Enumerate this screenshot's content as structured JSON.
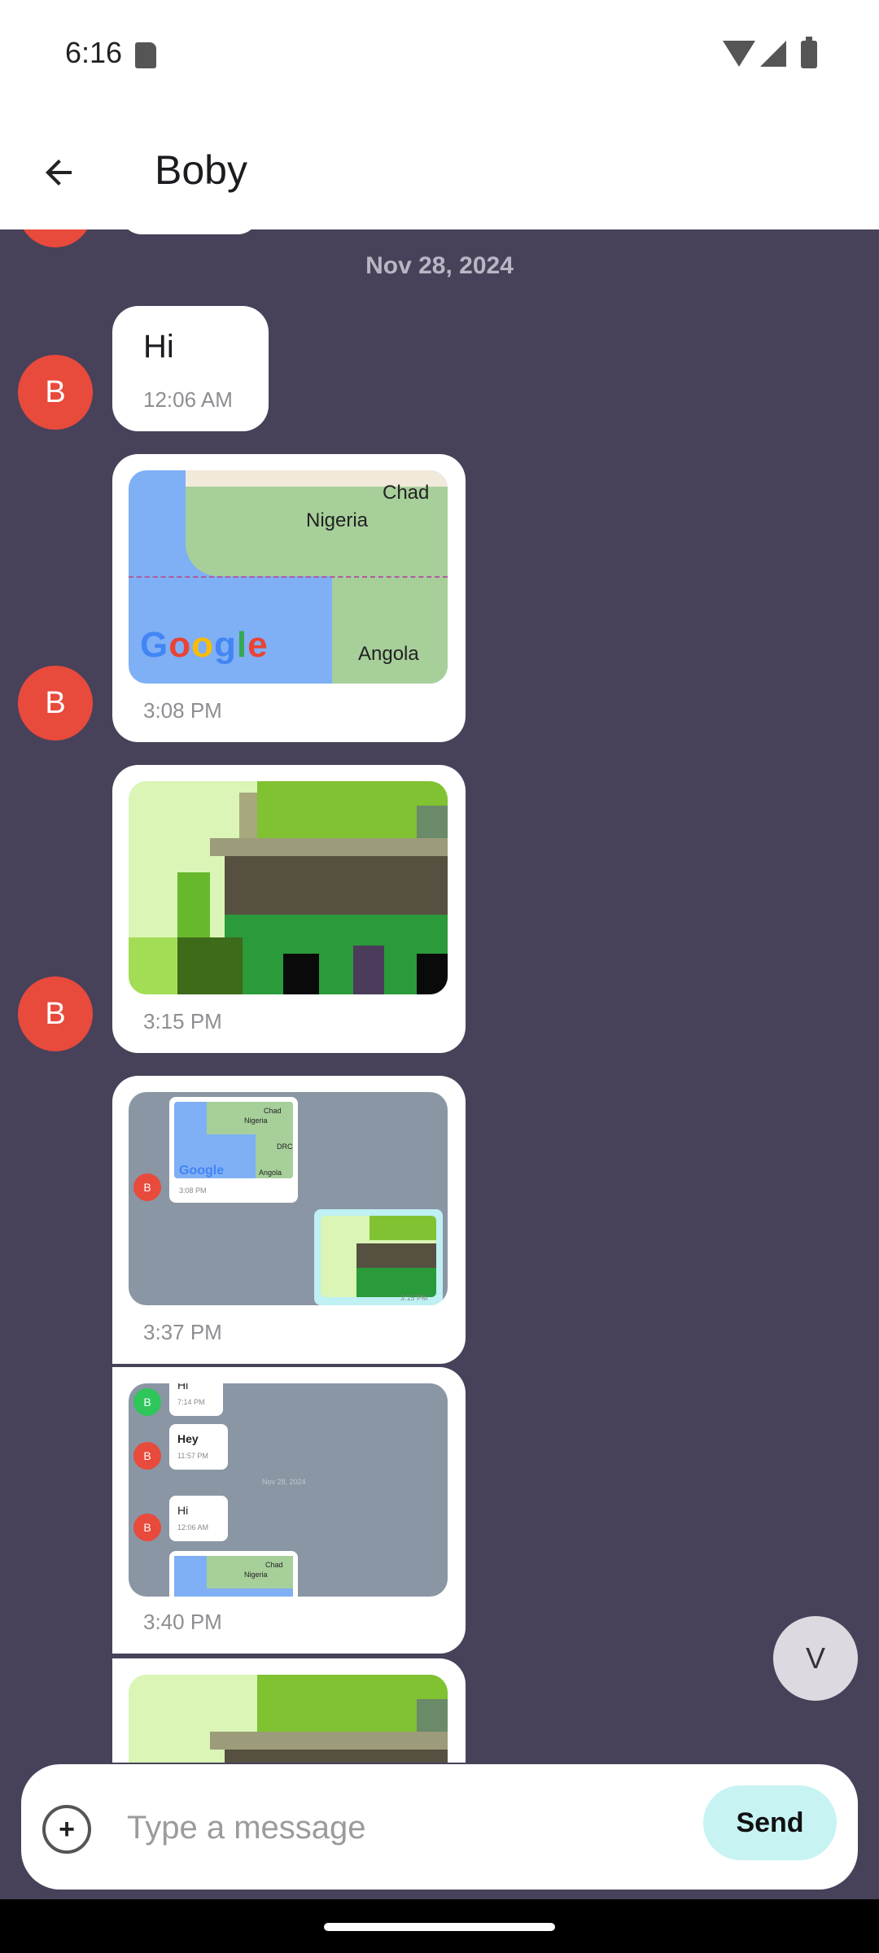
{
  "status_bar": {
    "time": "6:16",
    "icons": [
      "sd-card-icon",
      "wifi-icon",
      "signal-icon",
      "battery-icon"
    ]
  },
  "app_bar": {
    "title": "Boby",
    "back_icon": "arrow-left-icon"
  },
  "chat": {
    "date_separator": "Nov 28, 2024",
    "messages": [
      {
        "sender_initial": "B",
        "type": "text",
        "text": "Hi",
        "time": "12:06 AM"
      },
      {
        "sender_initial": "B",
        "type": "map",
        "time": "3:08 PM",
        "map_labels": [
          "Chad",
          "Nigeria",
          "Angola",
          "Google"
        ]
      },
      {
        "sender_initial": "B",
        "type": "image",
        "time": "3:15 PM"
      },
      {
        "type": "screenshot",
        "time": "3:37 PM",
        "inner": {
          "map_labels": [
            "Chad",
            "Nigeria",
            "DRC",
            "Angola",
            "Google"
          ],
          "avatar": "B",
          "time1": "3:08 PM",
          "time2": "3:15 PM"
        }
      },
      {
        "type": "screenshot",
        "time": "3:40 PM",
        "inner": {
          "avatar1": "B",
          "text1": "Hi",
          "time1": "7:14 PM",
          "avatar2": "B",
          "text2": "Hey",
          "time2": "11:57 PM",
          "date": "Nov 28, 2024",
          "avatar3": "B",
          "text3": "Hi",
          "time3": "12:06 AM",
          "map_labels": [
            "Chad",
            "Nigeria"
          ]
        }
      },
      {
        "type": "image",
        "time": ""
      }
    ]
  },
  "fab": {
    "initial": "V"
  },
  "composer": {
    "placeholder": "Type a message",
    "value": "",
    "attach_label": "+",
    "send_label": "Send"
  },
  "colors": {
    "chat_background": "#48415a",
    "avatar_red": "#e84a3c",
    "send_button": "#c7f3f3",
    "inner_screenshot_bg": "#8a96a4"
  }
}
